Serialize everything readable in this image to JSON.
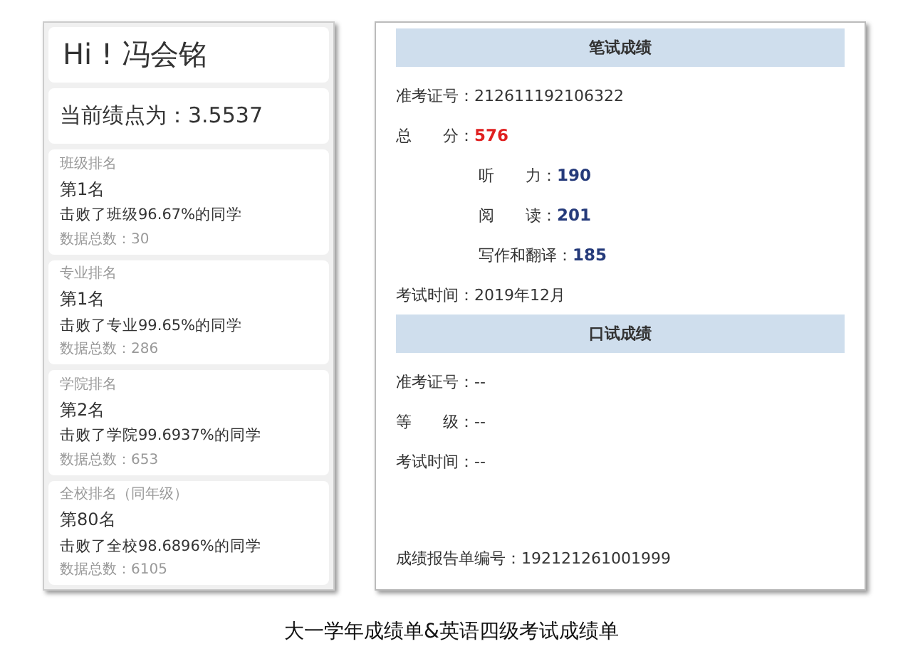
{
  "profile": {
    "greeting": "Hi ! 冯会铭",
    "gpa": "当前绩点为：3.5537",
    "rankings": [
      {
        "label": "班级排名",
        "rank": "第1名",
        "beat": "击败了班级96.67%的同学",
        "count": "数据总数：30"
      },
      {
        "label": "专业排名",
        "rank": "第1名",
        "beat": "击败了专业99.65%的同学",
        "count": "数据总数：286"
      },
      {
        "label": "学院排名",
        "rank": "第2名",
        "beat": "击败了学院99.6937%的同学",
        "count": "数据总数：653"
      },
      {
        "label": "全校排名（同年级）",
        "rank": "第80名",
        "beat": "击败了全校98.6896%的同学",
        "count": "数据总数：6105"
      }
    ]
  },
  "report": {
    "sections": [
      {
        "title": "笔试成绩",
        "rows": [
          {
            "kind": "plain",
            "text": "准考证号：212611192106322"
          },
          {
            "kind": "total",
            "label": "总　　分：",
            "value": "576"
          },
          {
            "kind": "sub",
            "label": "听　　力：",
            "value": "190"
          },
          {
            "kind": "sub",
            "label": "阅　　读：",
            "value": "201"
          },
          {
            "kind": "sub",
            "label": "写作和翻译：",
            "value": "185"
          },
          {
            "kind": "plain",
            "text": "考试时间：2019年12月"
          }
        ]
      },
      {
        "title": "口试成绩",
        "rows": [
          {
            "kind": "plain",
            "text": "准考证号：--"
          },
          {
            "kind": "plain",
            "text": "等　　级：--"
          },
          {
            "kind": "plain",
            "text": "考试时间：--"
          }
        ]
      }
    ],
    "footer": "成绩报告单编号：192121261001999"
  },
  "caption": "大一学年成绩单&英语四级考试成绩单"
}
